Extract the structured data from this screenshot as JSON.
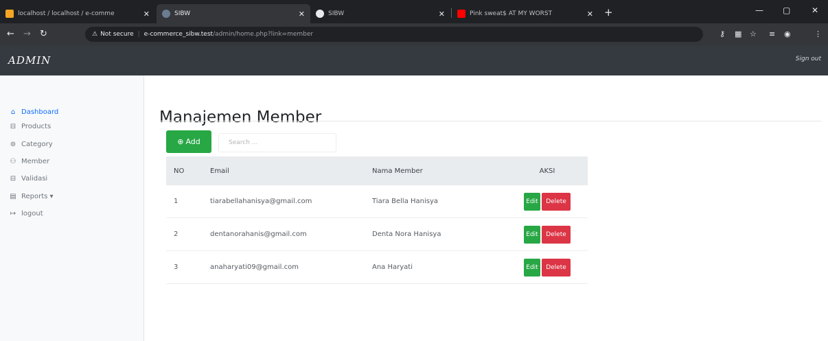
{
  "browser": {
    "tabs": [
      {
        "title": "localhost / localhost / e-comme",
        "active": false,
        "favicon_color": "#f5a623"
      },
      {
        "title": "SIBW",
        "active": true,
        "favicon_color": "#6b7c93"
      },
      {
        "title": "SIBW",
        "active": false,
        "favicon_color": "#e8eaed"
      },
      {
        "title": "Pink sweat$ AT MY WORST",
        "active": false,
        "favicon_color": "#ff0000"
      }
    ],
    "address": {
      "security_label": "Not secure",
      "host": "e-commerce_sibw.test",
      "path": "/admin/home.php?link=member"
    }
  },
  "navbar": {
    "brand": "ADMIN",
    "signout": "Sign out"
  },
  "sidebar": {
    "items": [
      {
        "label": "Dashboard",
        "icon": "home-icon",
        "glyph": "⌂",
        "active": true
      },
      {
        "label": "Products",
        "icon": "cart-icon",
        "glyph": "⊟",
        "active": false
      },
      {
        "label": "Category",
        "icon": "category-icon",
        "glyph": "⊚",
        "active": false
      },
      {
        "label": "Member",
        "icon": "users-icon",
        "glyph": "⚇",
        "active": false
      },
      {
        "label": "Validasi",
        "icon": "check-cart-icon",
        "glyph": "⊟",
        "active": false
      },
      {
        "label": "Reports ▾",
        "icon": "file-icon",
        "glyph": "▤",
        "active": false
      },
      {
        "label": "logout",
        "icon": "logout-icon",
        "glyph": "↦",
        "active": false
      }
    ]
  },
  "main": {
    "title": "Manajemen Member",
    "add_label": "Add",
    "search_placeholder": "Search ..."
  },
  "table": {
    "headers": [
      "NO",
      "Email",
      "Nama Member",
      "AKSI"
    ],
    "rows": [
      {
        "no": "1",
        "email": "tiarabellahanisya@gmail.com",
        "nama": "Tiara Bella Hanisya"
      },
      {
        "no": "2",
        "email": "dentanorahanis@gmail.com",
        "nama": "Denta Nora Hanisya"
      },
      {
        "no": "3",
        "email": "anaharyati09@gmail.com",
        "nama": "Ana Haryati"
      }
    ],
    "edit_label": "Edit",
    "delete_label": "Delete"
  },
  "colors": {
    "navbar": "#343a40",
    "success": "#28a745",
    "danger": "#dc3545",
    "link_active": "#0d6efd"
  }
}
